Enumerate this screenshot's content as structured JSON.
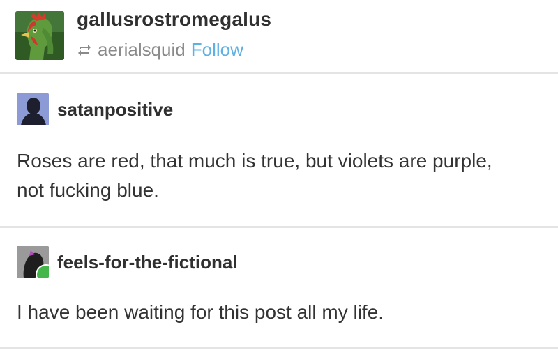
{
  "header": {
    "blog_name": "gallusrostromegalus",
    "reblog_user": "aerialsquid",
    "follow_label": "Follow"
  },
  "posts": [
    {
      "username": "satanpositive",
      "text": "Roses are red, that much is true, but violets are purple, not fucking blue."
    },
    {
      "username": "feels-for-the-fictional",
      "text": "I have been waiting for this post all my life."
    }
  ],
  "colors": {
    "follow_link": "#5fb0e5",
    "badge_green": "#45b649",
    "divider": "#e4e4e4"
  }
}
